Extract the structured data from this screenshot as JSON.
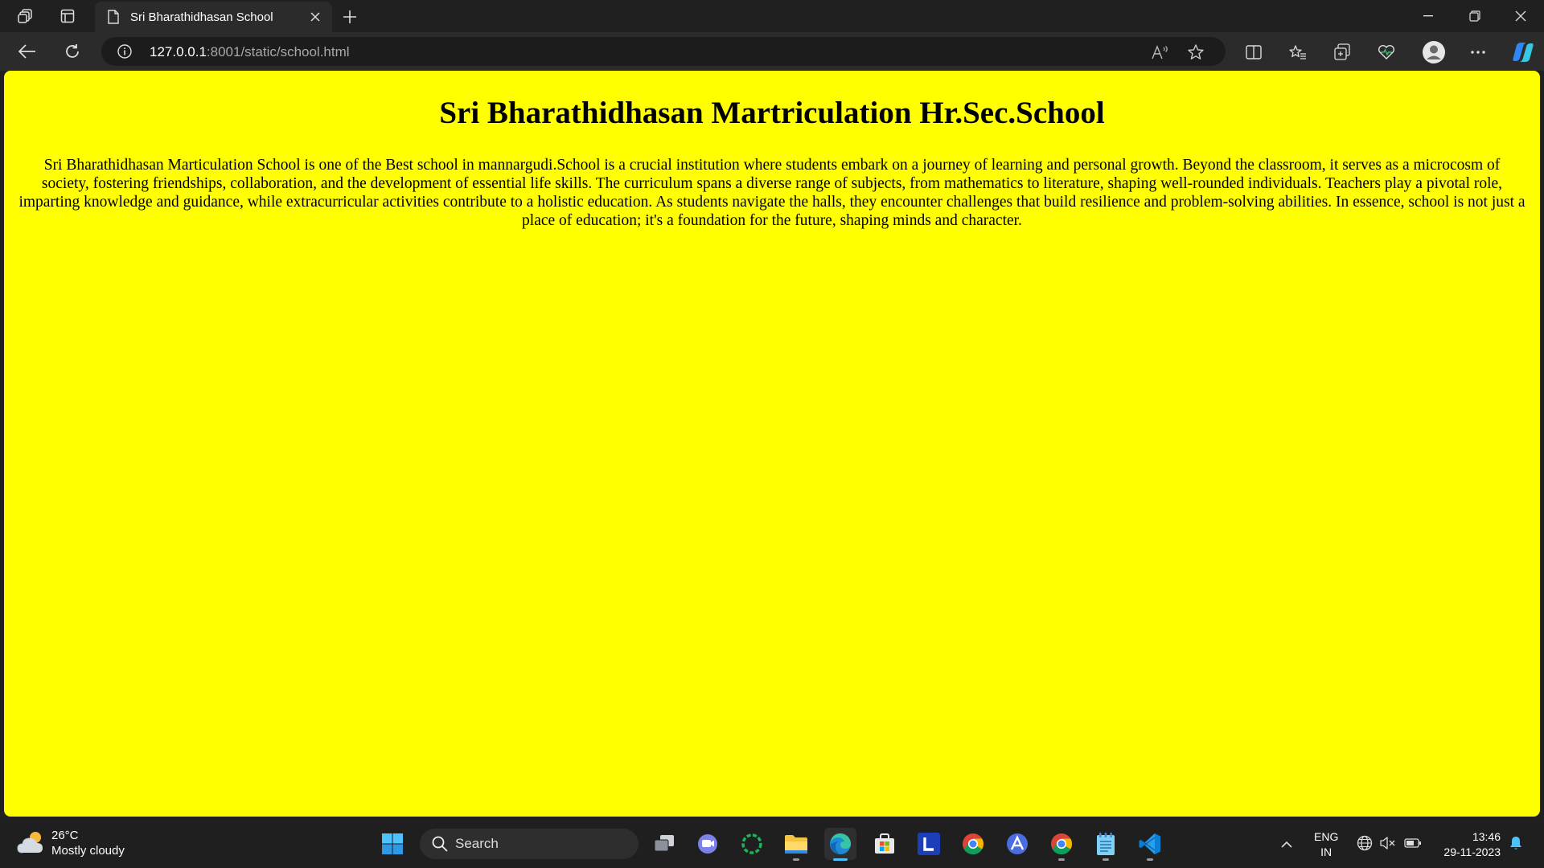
{
  "browser": {
    "tab": {
      "title": "Sri Bharathidhasan School"
    },
    "address": {
      "host": "127.0.0.1",
      "path": ":8001/static/school.html"
    }
  },
  "page": {
    "heading": "Sri Bharathidhasan Martriculation Hr.Sec.School",
    "paragraph": "Sri Bharathidhasan Marticulation School is one of the Best school in mannargudi.School is a crucial institution where students embark on a journey of learning and personal growth. Beyond the classroom, it serves as a microcosm of society, fostering friendships, collaboration, and the development of essential life skills. The curriculum spans a diverse range of subjects, from mathematics to literature, shaping well-rounded individuals. Teachers play a pivotal role, imparting knowledge and guidance, while extracurricular activities contribute to a holistic education. As students navigate the halls, they encounter challenges that build resilience and problem-solving abilities. In essence, school is not just a place of education; it's a foundation for the future, shaping minds and character.",
    "background": "#ffff00"
  },
  "taskbar": {
    "weather": {
      "temp": "26°C",
      "condition": "Mostly cloudy"
    },
    "search_label": "Search",
    "lang": {
      "line1": "ENG",
      "line2": "IN"
    },
    "clock": {
      "time": "13:46",
      "date": "29-11-2023"
    },
    "apps": [
      "task-view",
      "teams",
      "app-loader",
      "file-explorer",
      "edge",
      "microsoft-store",
      "l-app",
      "chrome",
      "arc-app",
      "chrome-profile",
      "notepad",
      "vscode"
    ]
  }
}
